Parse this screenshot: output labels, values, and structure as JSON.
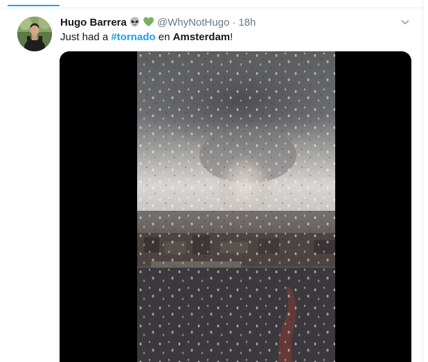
{
  "tweet": {
    "display_name": "Hugo Barrera",
    "emoji_1": "alien-emoji",
    "emoji_2": "green-heart-emoji",
    "handle": "@WhyNotHugo",
    "separator": "·",
    "timestamp": "18h",
    "text_prefix": "Just had a ",
    "hashtag": "#tornado",
    "text_middle": " en ",
    "place": "Amsterdam",
    "text_suffix": "!"
  },
  "icons": {
    "caret": "chevron-down-icon",
    "avatar": "user-avatar"
  },
  "colors": {
    "accent": "#1da1f2",
    "text": "#14171a",
    "secondary_text": "#657786",
    "border": "#e6ecf0",
    "media_background": "#000000"
  }
}
